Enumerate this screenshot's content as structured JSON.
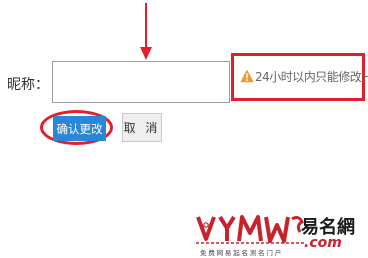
{
  "form": {
    "nickname_label": "昵称：",
    "nickname_value": "",
    "nickname_placeholder": "",
    "hint": "24小时以内只能修改一次"
  },
  "buttons": {
    "confirm_label": "确认更改",
    "cancel_label": "取 消"
  },
  "watermark": {
    "logo_text": "YMW",
    "site_name": "易名網",
    "domain": ".com",
    "slogan": "免费网易起名测名门户"
  },
  "colors": {
    "highlight_red": "#e0202a",
    "primary_blue": "#2a86d8",
    "warning_orange": "#f19a26",
    "watermark_red": "#c8232c"
  },
  "icons": {
    "arrow": "arrow-down-icon",
    "warning": "warning-icon"
  }
}
